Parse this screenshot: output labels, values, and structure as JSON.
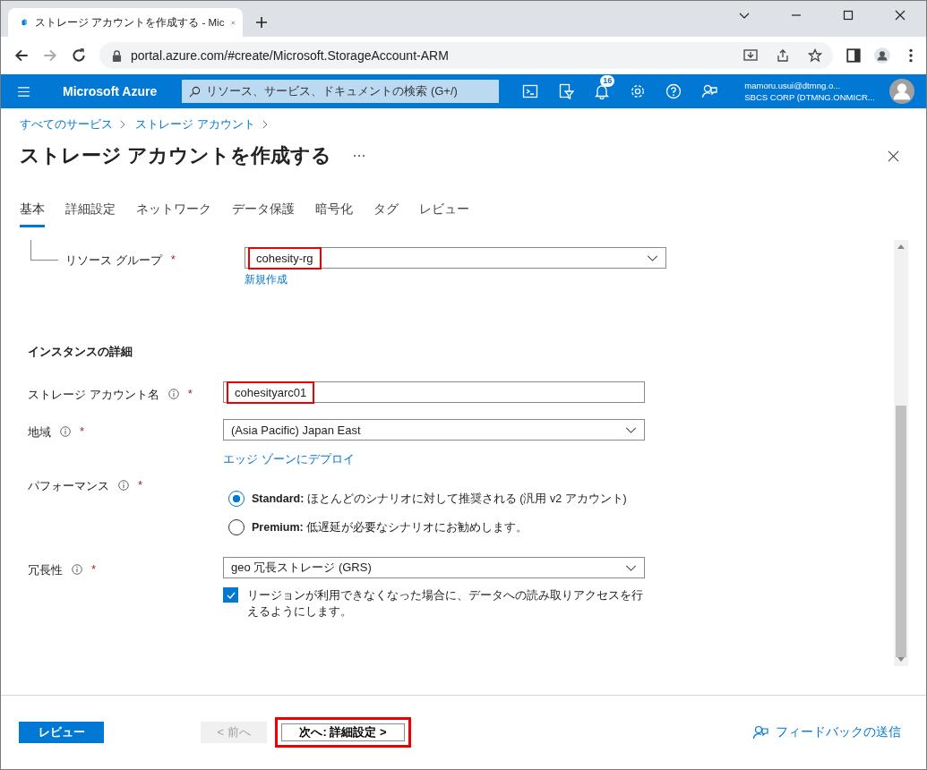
{
  "browser": {
    "tab_title": "ストレージ アカウントを作成する - Mic",
    "url": "portal.azure.com/#create/Microsoft.StorageAccount-ARM"
  },
  "topbar": {
    "brand": "Microsoft Azure",
    "search_placeholder": "リソース、サービス、ドキュメントの検索 (G+/)",
    "notification_count": "16",
    "user_email": "mamoru.usui@dtmng.o...",
    "user_directory": "SBCS CORP (DTMNG.ONMICR..."
  },
  "breadcrumb": [
    "すべてのサービス",
    "ストレージ アカウント"
  ],
  "title": "ストレージ アカウントを作成する",
  "tabs": [
    {
      "label": "基本",
      "selected": true
    },
    {
      "label": "詳細設定",
      "selected": false
    },
    {
      "label": "ネットワーク",
      "selected": false
    },
    {
      "label": "データ保護",
      "selected": false
    },
    {
      "label": "暗号化",
      "selected": false
    },
    {
      "label": "タグ",
      "selected": false
    },
    {
      "label": "レビュー",
      "selected": false
    }
  ],
  "resource_group": {
    "label": "リソース グループ",
    "required": "*",
    "value": "cohesity-rg",
    "highlighted": true,
    "link": "新規作成"
  },
  "section_heading": "インスタンスの詳細",
  "fields": [
    {
      "kind": "text",
      "label": "ストレージ アカウント名",
      "info": true,
      "required": "*",
      "value": "cohesityarc01",
      "highlighted": true
    },
    {
      "kind": "dropdown",
      "label": "地域",
      "info": true,
      "required": "*",
      "value": "(Asia Pacific) Japan East",
      "highlighted": false,
      "link": "エッジ ゾーンにデプロイ"
    },
    {
      "kind": "radio",
      "label": "パフォーマンス",
      "info": true,
      "required": "*",
      "options": [
        {
          "text": "**Standard:** ほとんどのシナリオに対して推奨される (汎用 v2 アカウント)",
          "selected": true
        },
        {
          "text": "**Premium:** 低遅延が必要なシナリオにお勧めします。",
          "selected": false
        }
      ]
    },
    {
      "kind": "dropdown",
      "label": "冗長性",
      "info": true,
      "required": "*",
      "value": "geo 冗長ストレージ (GRS)",
      "highlighted": false,
      "checkbox": {
        "text": "リージョンが利用できなくなった場合に、データへの読み取りアクセスを行えるようにします。",
        "checked": true
      }
    }
  ],
  "footer": {
    "review_button": "レビュー",
    "prev_button": {
      "label": "< 前へ",
      "disabled": true
    },
    "next_button": {
      "label": "次へ: 詳細設定 >",
      "highlighted": true
    },
    "feedback": "フィードバックの送信"
  }
}
